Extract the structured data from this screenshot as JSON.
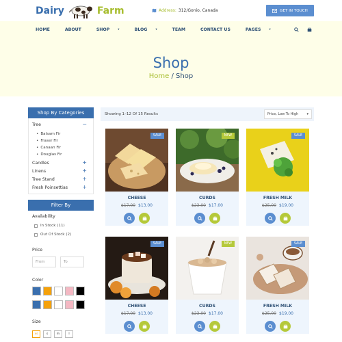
{
  "brand": {
    "part1": "Dairy",
    "part2": "Farm"
  },
  "header": {
    "address_label": "Address:",
    "address_value": "312/Gonio, Canada",
    "touch_button": "GET IN TOUCH"
  },
  "nav": {
    "items": [
      "HOME",
      "ABOUT",
      "SHOP",
      "BLOG",
      "TEAM",
      "CONTACT US",
      "PAGES"
    ],
    "has_caret": [
      false,
      false,
      true,
      true,
      false,
      false,
      true
    ]
  },
  "hero": {
    "title": "Shop",
    "crumb_home": "Home",
    "crumb_sep": " / ",
    "crumb_current": "Shop"
  },
  "sidebar": {
    "categories_title": "Shop By Categories",
    "categories": [
      {
        "label": "Tree",
        "sign": "−"
      },
      {
        "label": "Candles",
        "sign": "+"
      },
      {
        "label": "Linens",
        "sign": "+"
      },
      {
        "label": "Tree Stand",
        "sign": "+"
      },
      {
        "label": "Fresh Poinsettias",
        "sign": "+"
      }
    ],
    "tree_sub": [
      "Balsam Fir",
      "Fraser Fir",
      "Canaan Fir",
      "Douglas Fir"
    ],
    "filter_title": "Filter By",
    "availability_title": "Availability",
    "availability": [
      "In Stock (11)",
      "Out Of Stock (2)"
    ],
    "price_title": "Price",
    "price_from_placeholder": "From",
    "price_to_placeholder": "To",
    "color_title": "Color",
    "colors_row1": [
      "#3a6fae",
      "#f5a10a",
      "#ffffff",
      "#f4b8c3",
      "#000000"
    ],
    "colors_row2": [
      "#3a6fae",
      "#f5a10a",
      "#ffffff",
      "#f4b8c3",
      "#000000"
    ],
    "size_title": "Size",
    "sizes": [
      "xs",
      "s",
      "m",
      "l"
    ]
  },
  "results": {
    "showing": "Showing 1–12 Of 15 Results",
    "sort": "Price, Low To High"
  },
  "products": [
    {
      "name": "CHEESE",
      "old": "$17.00",
      "new": "$13.00",
      "badge": "SALE"
    },
    {
      "name": "CURDS",
      "old": "$23.00",
      "new": "$17.00",
      "badge": "NEW"
    },
    {
      "name": "FRESH MILK",
      "old": "$25.00",
      "new": "$19.00",
      "badge": "SALE"
    },
    {
      "name": "CHEESE",
      "old": "$17.00",
      "new": "$13.00",
      "badge": "SALE"
    },
    {
      "name": "CURDS",
      "old": "$23.00",
      "new": "$17.00",
      "badge": "NEW"
    },
    {
      "name": "FRESH MILK",
      "old": "$25.00",
      "new": "$19.00",
      "badge": "SALE"
    }
  ],
  "colors": {
    "primary": "#3a6fae",
    "accent": "#b5c93a",
    "hero_bg": "#fefee8",
    "card_bg": "#eef5fd"
  }
}
